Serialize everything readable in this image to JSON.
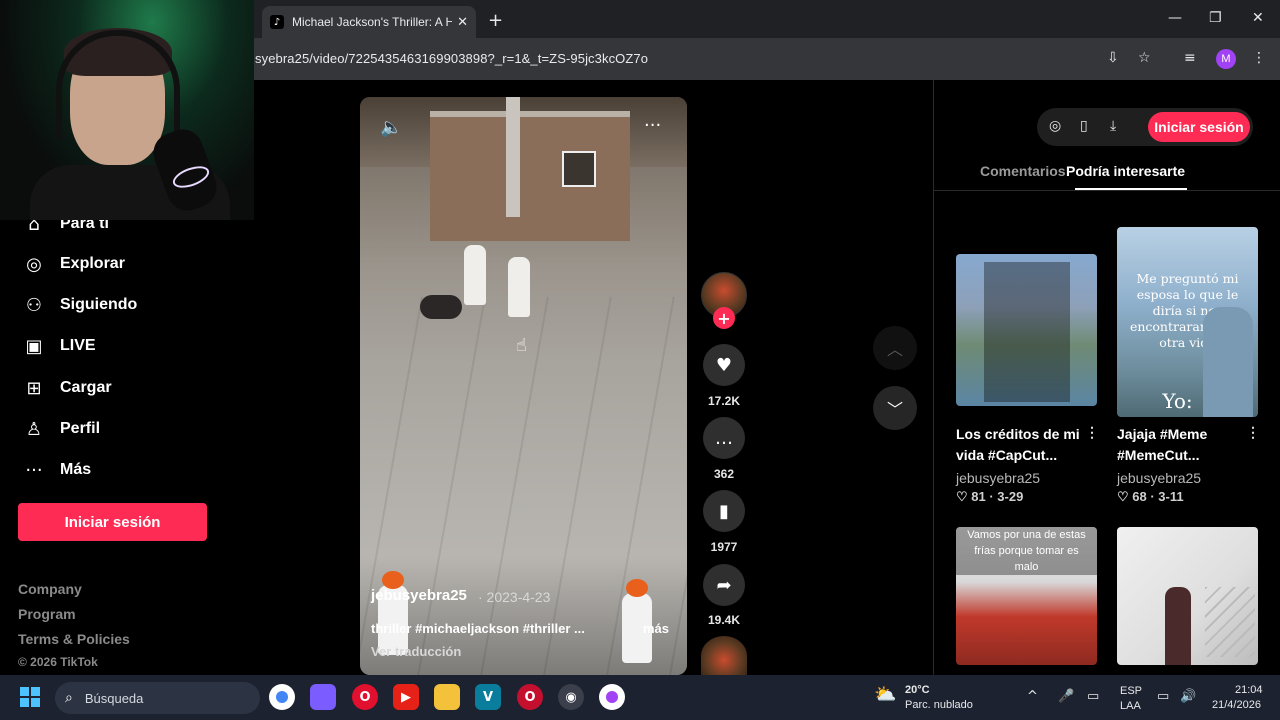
{
  "browser": {
    "tab_title": "Michael Jackson's Thriller: A Hu",
    "tab_favicon": "tiktok-icon",
    "url": "syebra25/video/7225435463169903898?_r=1&_t=ZS-95jc3kcOZ7o",
    "profile_initial": "M"
  },
  "sidebar": {
    "items": [
      {
        "label": "Para ti",
        "icon": "home-icon"
      },
      {
        "label": "Explorar",
        "icon": "compass-icon"
      },
      {
        "label": "Siguiendo",
        "icon": "following-icon"
      },
      {
        "label": "LIVE",
        "icon": "live-icon"
      },
      {
        "label": "Cargar",
        "icon": "upload-icon"
      },
      {
        "label": "Perfil",
        "icon": "profile-icon"
      },
      {
        "label": "Más",
        "icon": "more-icon"
      }
    ],
    "login_label": "Iniciar sesión",
    "footer_links": [
      "Company",
      "Program",
      "Terms & Policies"
    ],
    "copyright": "© 2026 TikTok"
  },
  "video": {
    "author": "jebusyebra25",
    "date": "· 2023-4-23",
    "caption": "thriller #michaeljackson #thriller ...",
    "more_label": "más",
    "translate_label": "Ver traducción"
  },
  "actions": {
    "likes": "17.2K",
    "comments": "362",
    "saves": "1977",
    "shares": "19.4K"
  },
  "right_panel": {
    "login_label": "Iniciar sesión",
    "tabs": [
      "Comentarios",
      "Podría interesarte"
    ],
    "active_tab": "Podría interesarte",
    "cards": [
      {
        "title_line1": "Los créditos de mi",
        "title_line2": "vida #CapCut...",
        "author": "jebusyebra25",
        "stats": "♡ 81 · 3-29"
      },
      {
        "title_line1": "Jajaja #Meme",
        "title_line2": "#MemeCut...",
        "author": "jebusyebra25",
        "stats": "♡ 68 · 3-11",
        "thumb_text_1": "Me preguntó mi esposa lo que le diría si nos encontraramos en otra vida",
        "thumb_text_2": "Yo:"
      },
      {
        "thumb_text_1": "Vamos por una de estas frías porque tomar es malo"
      },
      {}
    ]
  },
  "taskbar": {
    "search_placeholder": "Búsqueda",
    "weather_temp": "20°C",
    "weather_desc": "Parc. nublado",
    "lang_line1": "ESP",
    "lang_line2": "LAA",
    "time": "21:04",
    "date": "21/4/2026"
  },
  "colors": {
    "accent": "#fe2c55",
    "background": "#000000",
    "taskbar": "#1c2230"
  }
}
